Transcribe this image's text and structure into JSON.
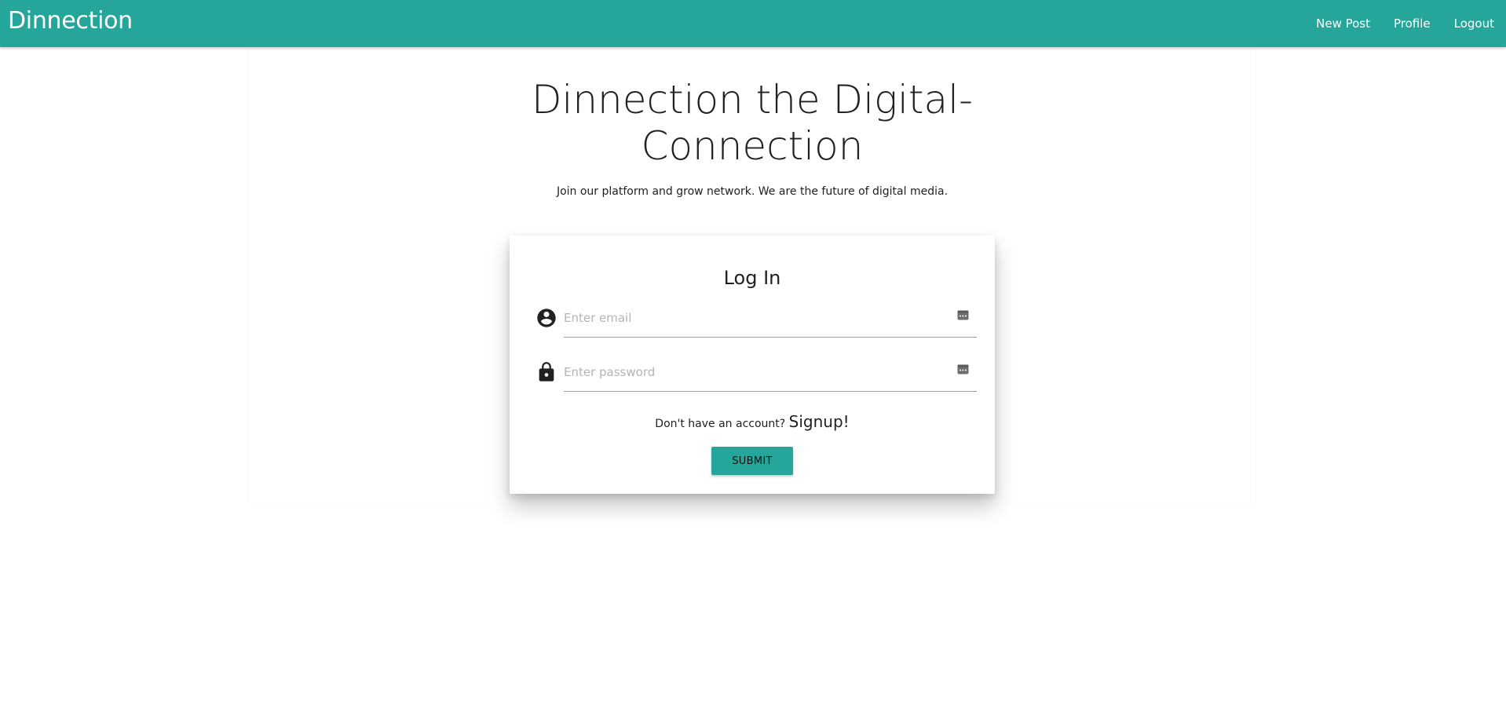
{
  "navbar": {
    "brand": "Dinnection",
    "links": [
      "New Post",
      "Profile",
      "Logout"
    ],
    "background": "#26a69a"
  },
  "hero": {
    "title_line1": "Dinnection the Digital-",
    "title_line2": "Connection",
    "subtitle": "Join our platform and grow network. We are the future of digital media."
  },
  "login": {
    "title": "Log In",
    "email": {
      "placeholder": "Enter email",
      "value": "",
      "icon": "account-circle-icon"
    },
    "password": {
      "placeholder": "Enter password",
      "value": "",
      "icon": "lock-icon"
    },
    "signup_prompt": "Don't have an account?",
    "signup_link": "Signup!",
    "submit_label": "SUBMIT"
  },
  "colors": {
    "accent": "#26a69a",
    "text": "#212121"
  }
}
